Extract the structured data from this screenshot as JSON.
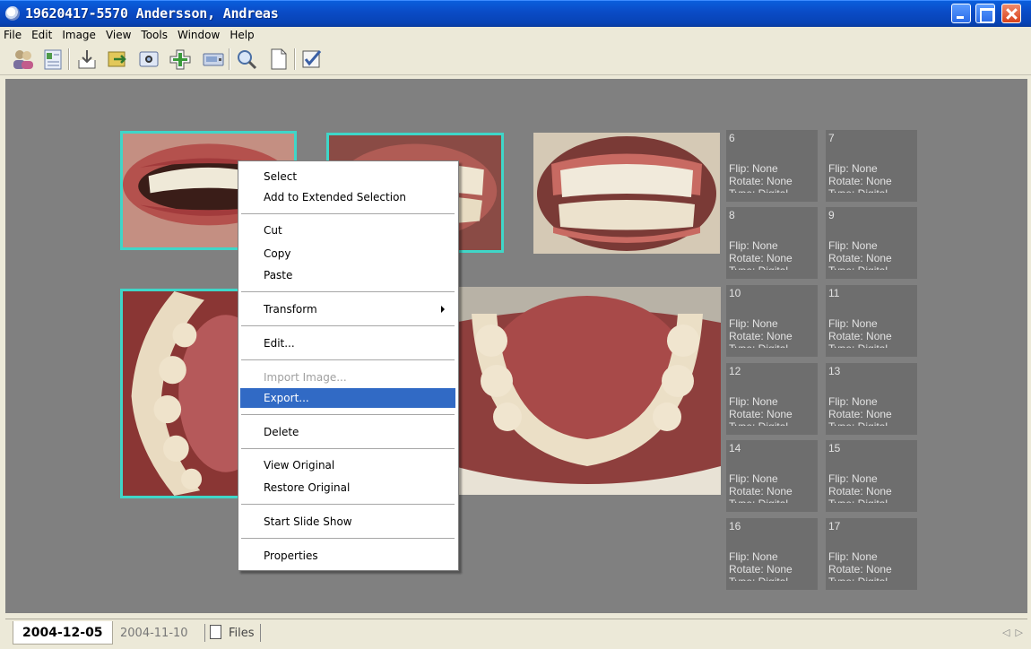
{
  "window": {
    "title": "19620417-5570 Andersson, Andreas"
  },
  "menu": [
    "File",
    "Edit",
    "Image",
    "View",
    "Tools",
    "Window",
    "Help"
  ],
  "toolbar": {
    "icons": [
      "patients-icon",
      "patient-card-icon",
      "import-icon",
      "acquire-icon",
      "camera-icon",
      "add-icon",
      "scanner-icon",
      "zoom-icon",
      "new-page-icon",
      "checklist-icon"
    ]
  },
  "tiles": [
    {
      "num": "6",
      "flip": "Flip: None",
      "rotate": "Rotate: None",
      "type": "Type: Digital"
    },
    {
      "num": "7",
      "flip": "Flip: None",
      "rotate": "Rotate: None",
      "type": "Type: Digital"
    },
    {
      "num": "8",
      "flip": "Flip: None",
      "rotate": "Rotate: None",
      "type": "Type: Digital"
    },
    {
      "num": "9",
      "flip": "Flip: None",
      "rotate": "Rotate: None",
      "type": "Type: Digital"
    },
    {
      "num": "10",
      "flip": "Flip: None",
      "rotate": "Rotate: None",
      "type": "Type: Digital"
    },
    {
      "num": "11",
      "flip": "Flip: None",
      "rotate": "Rotate: None",
      "type": "Type: Digital"
    },
    {
      "num": "12",
      "flip": "Flip: None",
      "rotate": "Rotate: None",
      "type": "Type: Digital"
    },
    {
      "num": "13",
      "flip": "Flip: None",
      "rotate": "Rotate: None",
      "type": "Type: Digital"
    },
    {
      "num": "14",
      "flip": "Flip: None",
      "rotate": "Rotate: None",
      "type": "Type: Digital"
    },
    {
      "num": "15",
      "flip": "Flip: None",
      "rotate": "Rotate: None",
      "type": "Type: Digital"
    },
    {
      "num": "16",
      "flip": "Flip: None",
      "rotate": "Rotate: None",
      "type": "Type: Digital"
    },
    {
      "num": "17",
      "flip": "Flip: None",
      "rotate": "Rotate: None",
      "type": "Type: Digital"
    }
  ],
  "context_menu": {
    "select": "Select",
    "add_extended": "Add to Extended Selection",
    "cut": "Cut",
    "copy": "Copy",
    "paste": "Paste",
    "transform": "Transform",
    "edit": "Edit...",
    "import_image": "Import Image...",
    "export": "Export...",
    "delete": "Delete",
    "view_original": "View Original",
    "restore_original": "Restore Original",
    "slide_show": "Start Slide Show",
    "properties": "Properties"
  },
  "tabs": {
    "active": "2004-12-05",
    "second": "2004-11-10",
    "files": "Files"
  },
  "colors": {
    "selection_border": "#3fd6c8",
    "menu_highlight": "#316ac5",
    "workspace": "#808080"
  }
}
